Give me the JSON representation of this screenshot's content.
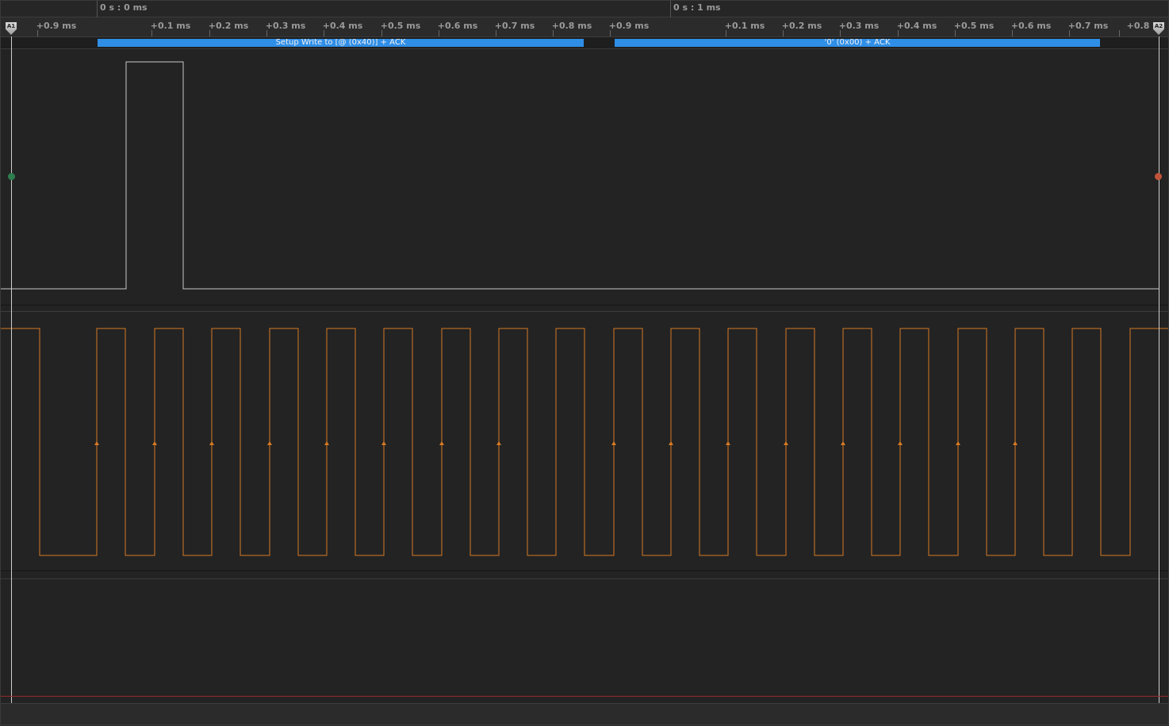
{
  "ruler": {
    "major_labels": [
      "0 s : 0 ms",
      "0 s : 1 ms"
    ],
    "minor_labels": [
      "+0.9 ms",
      "+0.1 ms",
      "+0.2 ms",
      "+0.3 ms",
      "+0.4 ms",
      "+0.5 ms",
      "+0.6 ms",
      "+0.7 ms",
      "+0.8 ms",
      "+0.9 ms",
      "+0.1 ms",
      "+0.2 ms",
      "+0.3 ms",
      "+0.4 ms",
      "+0.5 ms",
      "+0.6 ms",
      "+0.7 ms",
      "+0.8"
    ]
  },
  "markers": {
    "a1": "A1",
    "a2": "A2"
  },
  "protocol": {
    "frame1": "Setup Write to [@ (0x40)] + ACK",
    "frame2": "'0' (0x00) + ACK"
  },
  "colors": {
    "background": "#232323",
    "data_trace": "#c8c8c8",
    "clock_trace": "#d67a24",
    "protocol_bar": "#2f8ee6",
    "left_dot": "#2e7d4f",
    "right_dot": "#c0543a"
  }
}
